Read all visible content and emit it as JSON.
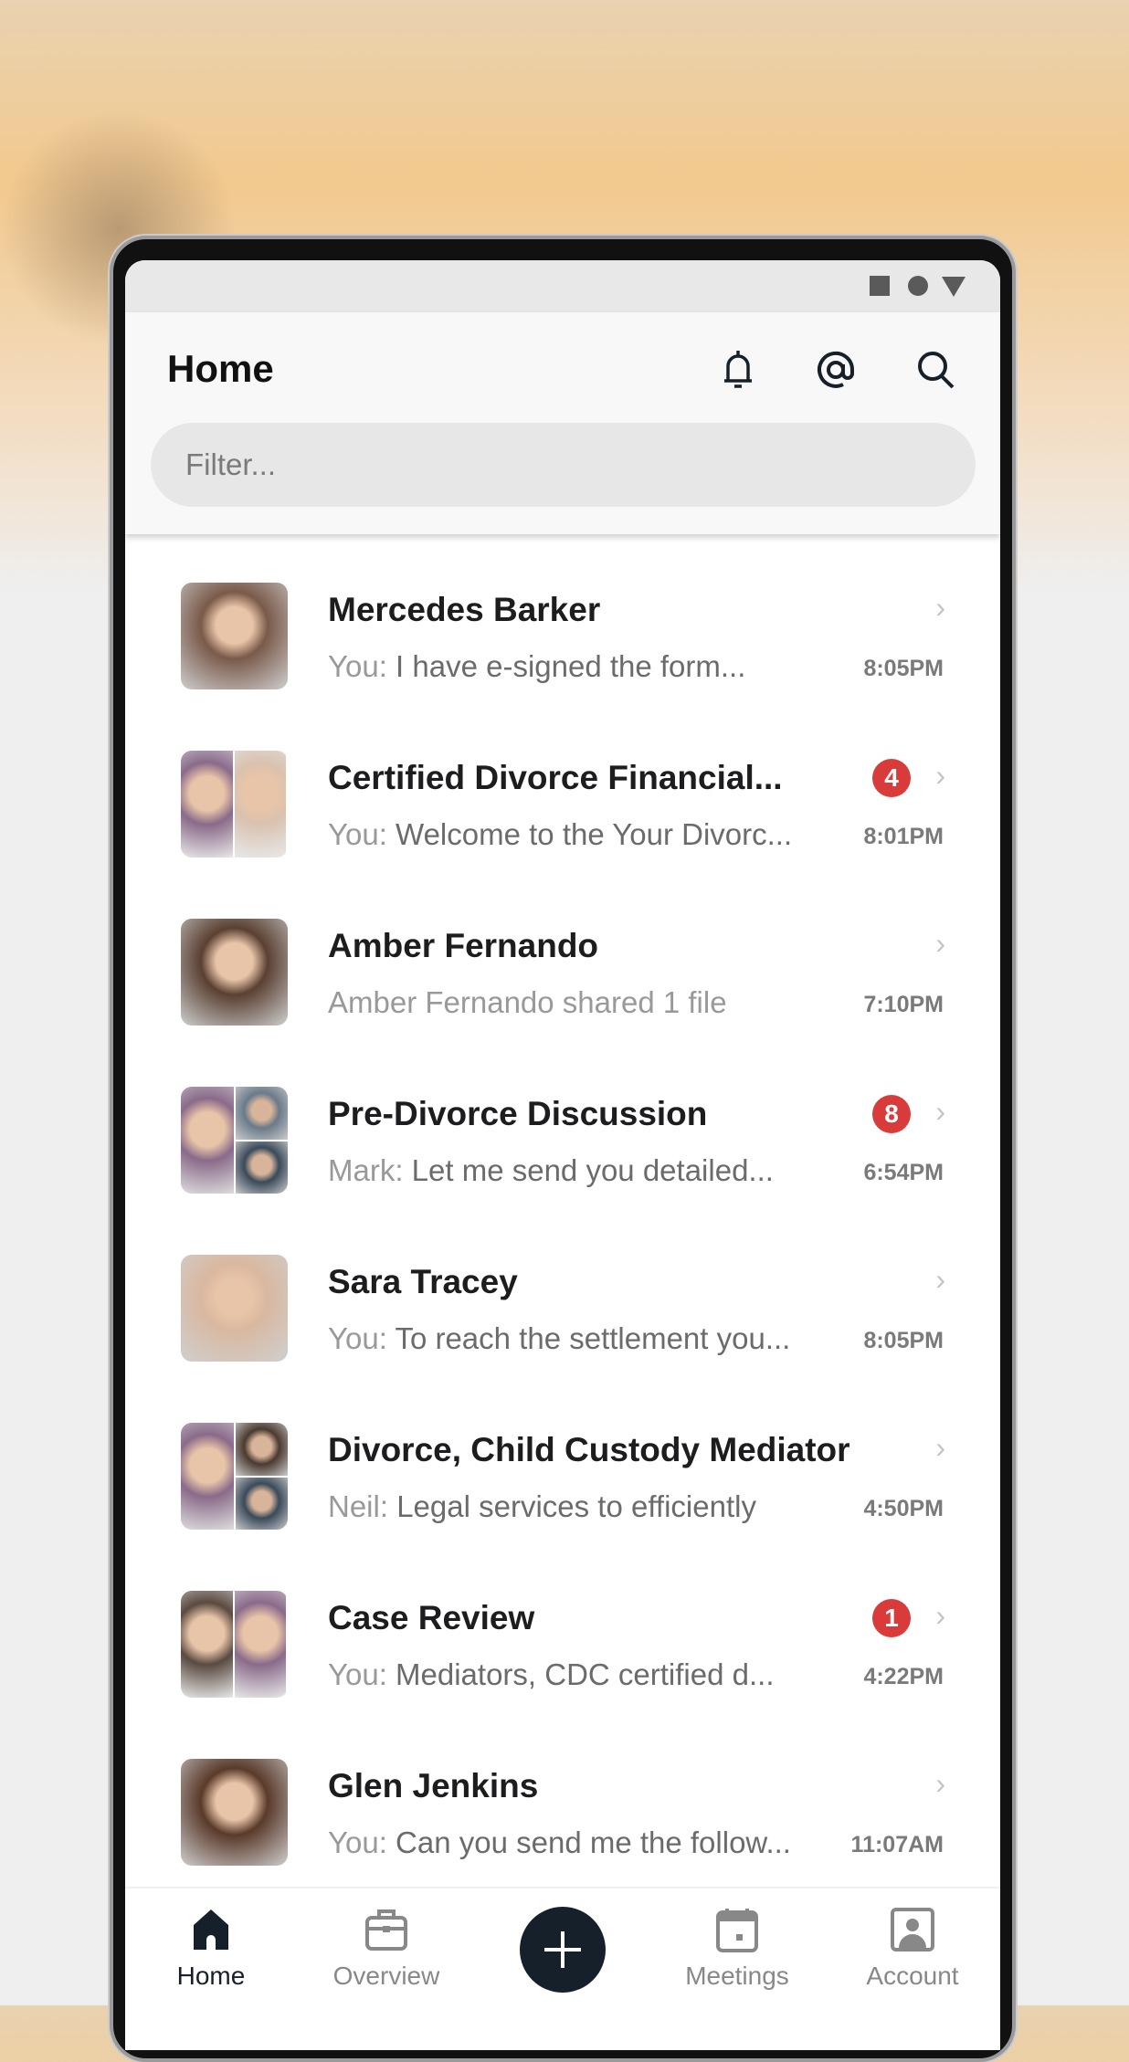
{
  "header": {
    "title": "Home",
    "filter_placeholder": "Filter..."
  },
  "conversations": [
    {
      "name": "Mercedes Barker",
      "prefix": "You:",
      "message": "I have e-signed the form...",
      "time": "8:05PM",
      "badge": null
    },
    {
      "name": "Certified Divorce Financial...",
      "prefix": "You:",
      "message": "Welcome to the Your Divorc...",
      "time": "8:01PM",
      "badge": "4"
    },
    {
      "name": "Amber Fernando",
      "prefix": "Amber Fernando shared 1 file",
      "message": "",
      "time": "7:10PM",
      "badge": null
    },
    {
      "name": "Pre-Divorce Discussion",
      "prefix": "Mark:",
      "message": "Let me send you detailed...",
      "time": "6:54PM",
      "badge": "8"
    },
    {
      "name": "Sara Tracey",
      "prefix": "You:",
      "message": "To reach the settlement you...",
      "time": "8:05PM",
      "badge": null
    },
    {
      "name": "Divorce, Child Custody Mediator",
      "prefix": "Neil:",
      "message": "Legal services to efficiently",
      "time": "4:50PM",
      "badge": null
    },
    {
      "name": "Case Review",
      "prefix": "You:",
      "message": "Mediators, CDC certified d...",
      "time": "4:22PM",
      "badge": "1"
    },
    {
      "name": "Glen Jenkins",
      "prefix": "You:",
      "message": "Can you send me the follow...",
      "time": "11:07AM",
      "badge": null
    }
  ],
  "nav": {
    "home": "Home",
    "overview": "Overview",
    "meetings": "Meetings",
    "account": "Account"
  },
  "colors": {
    "badge": "#d93b3b",
    "primary": "#16202b",
    "active_nav": "#16202b",
    "inactive_nav": "#888888"
  }
}
